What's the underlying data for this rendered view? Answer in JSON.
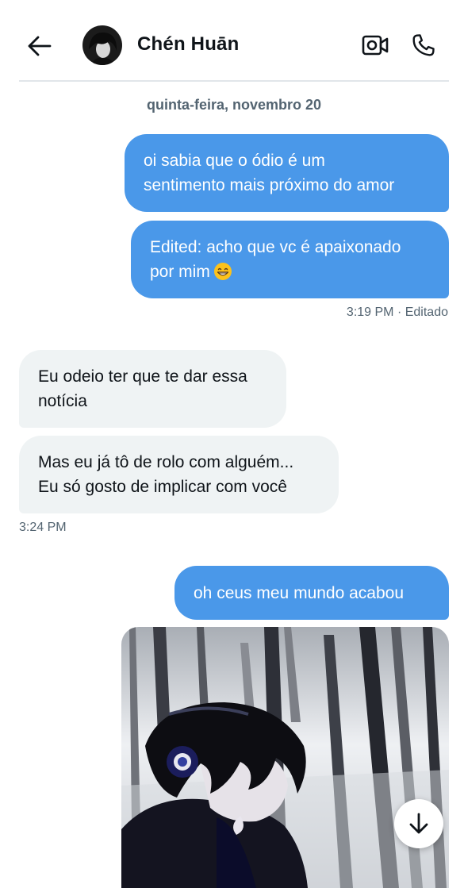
{
  "header": {
    "contact_name": "Chén Huān",
    "back_icon": "arrow-left-icon",
    "video_icon": "video-camera-icon",
    "call_icon": "phone-icon"
  },
  "conversation": {
    "date_separator": "quinta-feira, novembro 20",
    "messages": [
      {
        "direction": "out",
        "text": "oi sabia que o ódio é um\nsentimento mais próximo do amor"
      },
      {
        "direction": "out",
        "text": "Edited: acho que vc é apaixonado\npor mim",
        "emoji": "grinning-face-icon"
      },
      {
        "direction": "in",
        "text": "Eu odeio ter que te dar essa\nnotícia"
      },
      {
        "direction": "in",
        "text": "Mas eu já tô de rolo com alguém...\nEu só gosto de implicar com você"
      },
      {
        "direction": "out",
        "text": "oh ceus meu mundo acabou"
      }
    ],
    "sent_meta": "3:19 PM · Editado",
    "received_meta": "3:24 PM",
    "media": "anime-character-headphones-image"
  },
  "colors": {
    "outgoing_bubble": "#4a98e9",
    "incoming_bubble": "#eff3f4",
    "meta_text": "#536471"
  },
  "scroll_button_icon": "arrow-down-icon"
}
